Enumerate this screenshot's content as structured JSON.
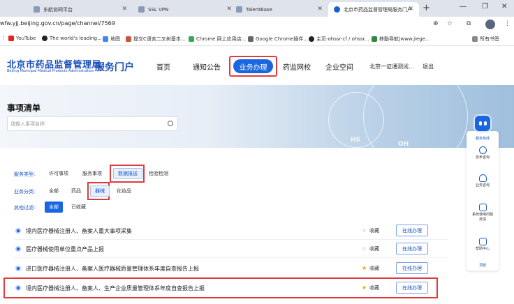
{
  "browser": {
    "tabs": [
      {
        "label": "东航协同平台"
      },
      {
        "label": "SSL VPN"
      },
      {
        "label": "TalentBase"
      },
      {
        "label": "北京市药品监督管理局服务门户"
      }
    ],
    "new_tab": "+",
    "window_controls": [
      "—",
      "❐",
      "✕"
    ],
    "url": "wfw.yjj.beijing.gov.cn/page/channel/7569",
    "bookmarks": [
      {
        "label": "YouTube",
        "color": "#e62117"
      },
      {
        "label": "The world's leading...",
        "color": "#222222"
      },
      {
        "label": "地图",
        "color": "#4285f4"
      },
      {
        "label": "提交C语言二叉树基本...",
        "color": "#c8553d"
      },
      {
        "label": "Chrome 网上应用店...",
        "color": "#34a853"
      },
      {
        "label": "Google Chrome插件...",
        "color": "#666666"
      },
      {
        "label": "主页-ohssr-cf / ohssr...",
        "color": "#222222"
      },
      {
        "label": "移動导航|www.jiege...",
        "color": "#2d8a3e"
      }
    ],
    "all_bookmarks": "所有书签"
  },
  "header": {
    "logo_cn": "北京市药品监督管理局",
    "logo_en": "Beijing Municipal Medical Products Administration",
    "portal": "服务门户",
    "nav": [
      "首页",
      "通知公告",
      "业务办理",
      "药监网校",
      "企业空间"
    ],
    "active_nav": "业务办理",
    "user": "北京一证通测试...",
    "logout": "退出"
  },
  "banner": {
    "title": "事项清单",
    "search_placeholder": "请输入事项名称",
    "deco_text": [
      "HS",
      "OH"
    ]
  },
  "filters": {
    "service_type": {
      "label": "服务类型:",
      "options": [
        "许可事项",
        "服务事项",
        "数据报送",
        "检验检测"
      ],
      "selected": "数据报送"
    },
    "business_category": {
      "label": "业务分类:",
      "options": [
        "全部",
        "药品",
        "器械",
        "化妆品"
      ],
      "selected": "器械"
    },
    "other": {
      "label": "其他过滤:",
      "options": [
        "全部",
        "已收藏"
      ],
      "selected": "全部"
    }
  },
  "items": [
    {
      "title": "境内医疗器械注册人、备案人重大事项采集",
      "fav_label": "收藏",
      "favorited": false,
      "action": "在线办理"
    },
    {
      "title": "医疗器械使用单位重点产品上报",
      "fav_label": "收藏",
      "favorited": false,
      "action": "在线办理"
    },
    {
      "title": "进口医疗器械注册人、备案人医疗器械质量管理体系年度自查报告上报",
      "fav_label": "收藏",
      "favorited": true,
      "action": "在线办理"
    },
    {
      "title": "境内医疗器械注册人、备案人、生产企业质量管理体系年度自查报告上报",
      "fav_label": "收藏",
      "favorited": true,
      "action": "在线办理"
    }
  ],
  "side_widget": {
    "hotline": "服务热线",
    "items": [
      "技术咨询",
      "业务咨询",
      "系统使用问题反馈",
      "帮助中心"
    ],
    "back_top": "顶部"
  },
  "colors": {
    "brand": "#1a4fb8",
    "accent": "#1a66e0",
    "highlight": "#e03b3b",
    "star": "#e0a800"
  }
}
